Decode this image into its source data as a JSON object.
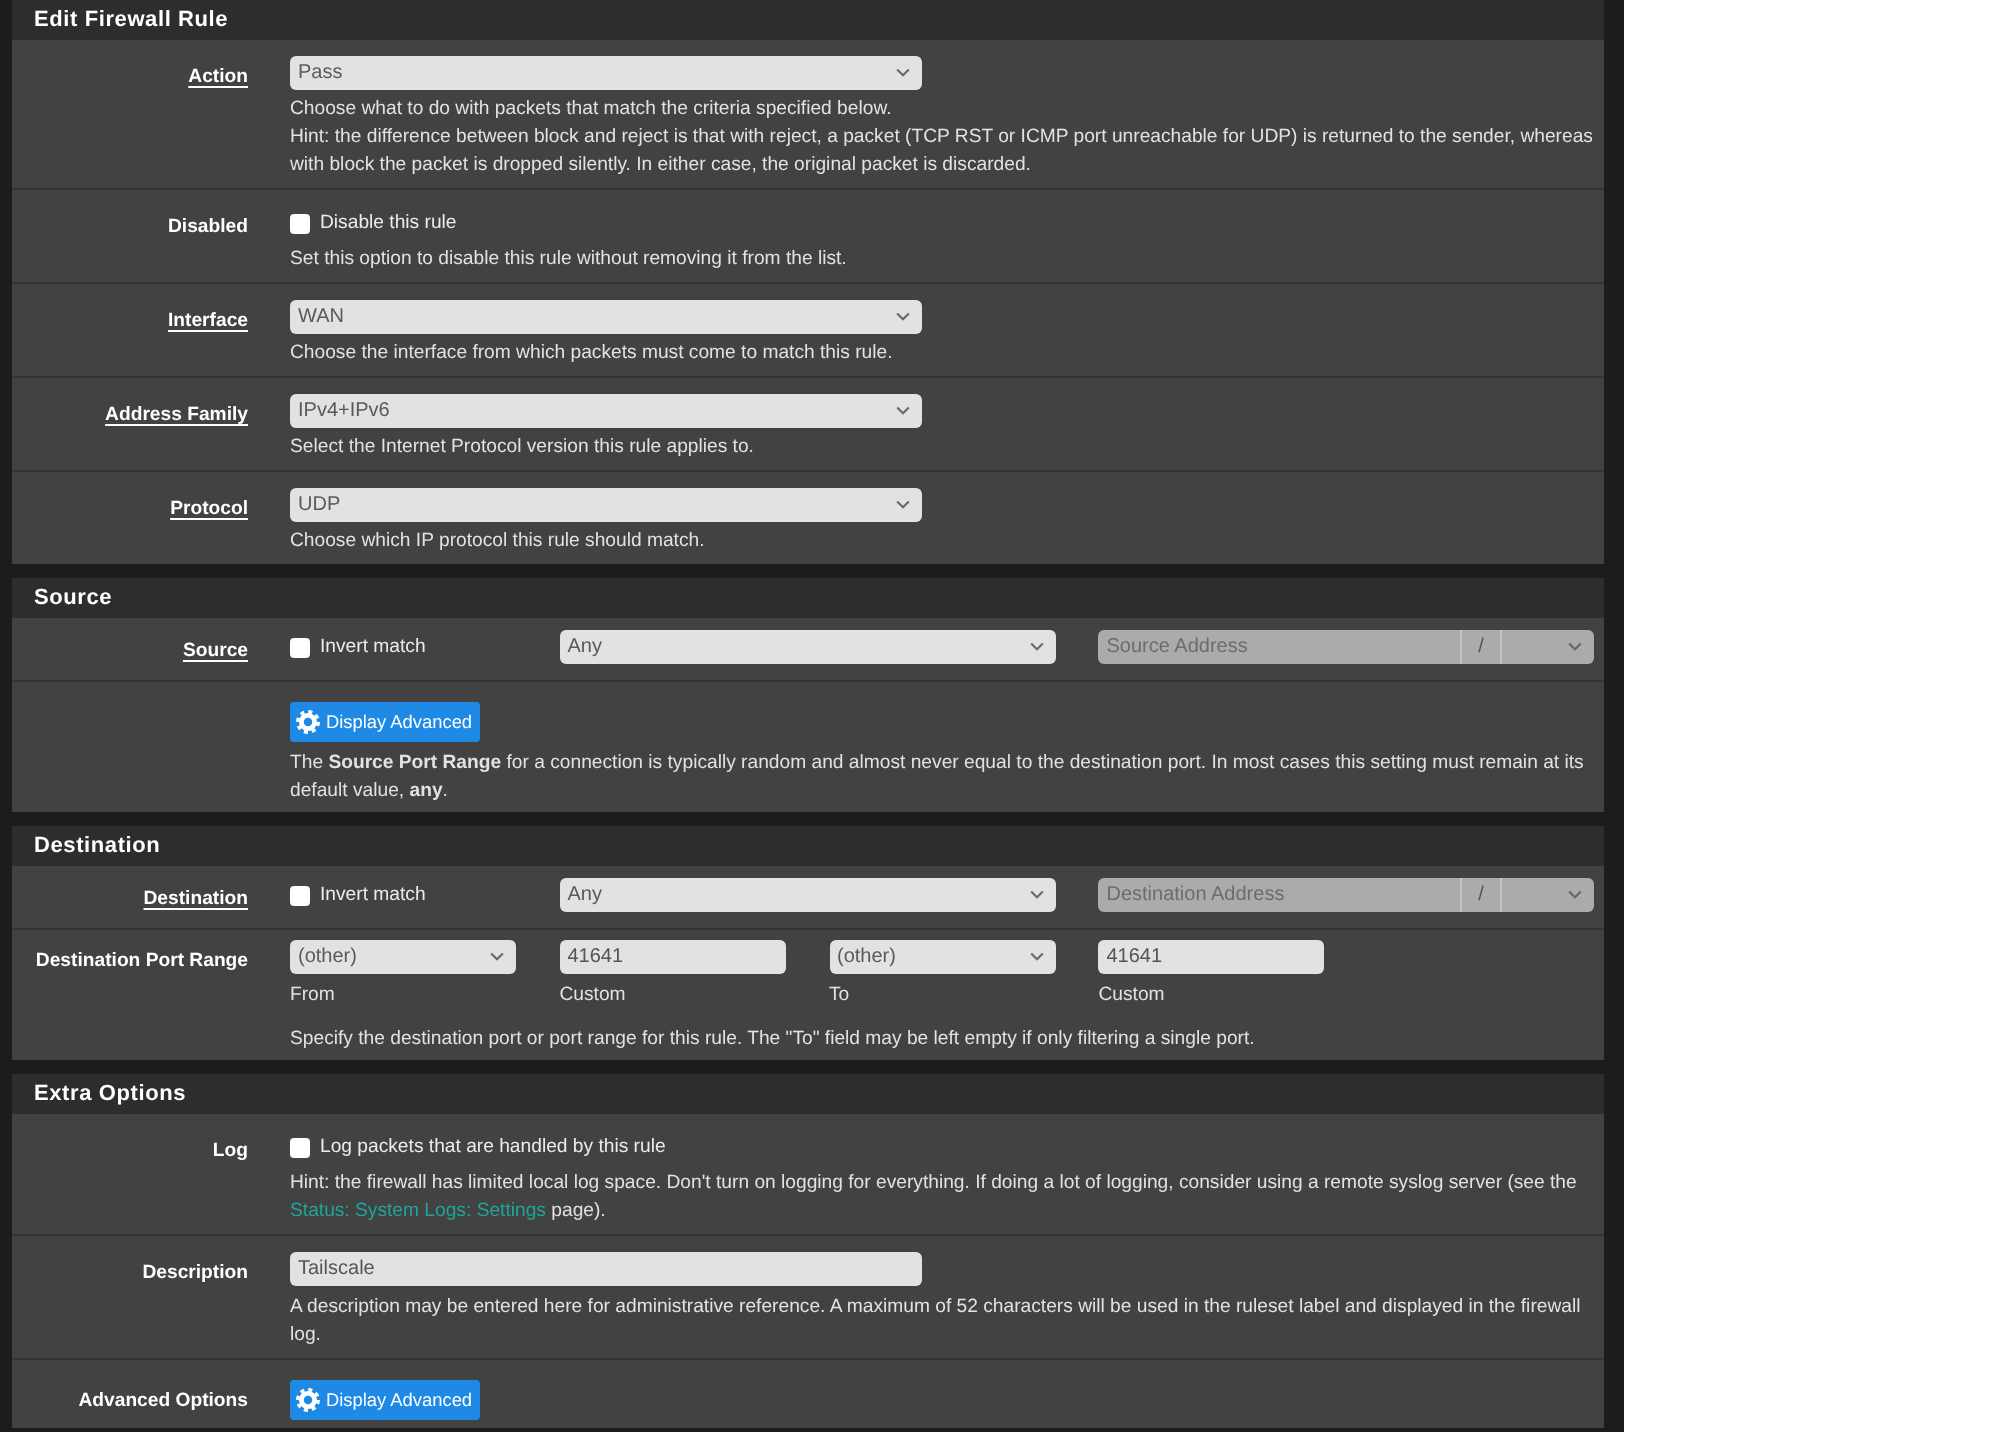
{
  "panels": [
    {
      "title": "Edit Firewall Rule",
      "rows": [
        {
          "kind": "select",
          "label": "Action",
          "link": true,
          "value": "Pass",
          "help": [
            "Choose what to do with packets that match the criteria specified below.",
            "Hint: the difference between block and reject is that with reject, a packet (TCP RST or ICMP port unreachable for UDP) is returned to the sender, whereas with block the packet is dropped silently. In either case, the original packet is discarded."
          ]
        },
        {
          "kind": "checkbox",
          "label": "Disabled",
          "link": false,
          "checkbox": {
            "label": "Disable this rule",
            "checked": false
          },
          "help": [
            "Set this option to disable this rule without removing it from the list."
          ]
        },
        {
          "kind": "select",
          "label": "Interface",
          "link": true,
          "value": "WAN",
          "help": [
            "Choose the interface from which packets must come to match this rule."
          ]
        },
        {
          "kind": "select",
          "label": "Address Family",
          "link": true,
          "value": "IPv4+IPv6",
          "help": [
            "Select the Internet Protocol version this rule applies to."
          ]
        },
        {
          "kind": "select",
          "label": "Protocol",
          "link": true,
          "value": "UDP",
          "help": [
            "Choose which IP protocol this rule should match."
          ]
        }
      ]
    },
    {
      "title": "Source",
      "rows": [
        {
          "kind": "address",
          "label": "Source",
          "link": true,
          "invert": {
            "label": "Invert match",
            "checked": false
          },
          "value": "Any",
          "address": {
            "placeholder": "Source Address",
            "separator": "/",
            "disabled": true
          }
        },
        {
          "kind": "advanced",
          "button": "Display Advanced",
          "help": [
            "The **Source Port Range** for a connection is typically random and almost never equal to the destination port. In most cases this setting must remain at its default value, **any**."
          ]
        }
      ]
    },
    {
      "title": "Destination",
      "rows": [
        {
          "kind": "address",
          "label": "Destination",
          "link": true,
          "invert": {
            "label": "Invert match",
            "checked": false
          },
          "value": "Any",
          "address": {
            "placeholder": "Destination Address",
            "separator": "/",
            "disabled": true
          }
        },
        {
          "kind": "port_range",
          "label": "Destination Port Range",
          "link": false,
          "fields": [
            {
              "kind": "select",
              "value": "(other)",
              "caption": "From"
            },
            {
              "kind": "input",
              "value": "41641",
              "caption": "Custom"
            },
            {
              "kind": "select",
              "value": "(other)",
              "caption": "To"
            },
            {
              "kind": "input",
              "value": "41641",
              "caption": "Custom"
            }
          ],
          "help": [
            "Specify the destination port or port range for this rule. The \"To\" field may be left empty if only filtering a single port."
          ]
        }
      ]
    },
    {
      "title": "Extra Options",
      "rows": [
        {
          "kind": "checkbox",
          "label": "Log",
          "link": false,
          "checkbox": {
            "label": "Log packets that are handled by this rule",
            "checked": false
          },
          "hint": {
            "before": "Hint: the firewall has limited local log space. Don't turn on logging for everything. If doing a lot of logging, consider using a remote syslog server (see the ",
            "link": "Status: System Logs: Settings",
            "after": " page)."
          }
        },
        {
          "kind": "input",
          "label": "Description",
          "link": false,
          "value": "Tailscale",
          "help": [
            "A description may be entered here for administrative reference. A maximum of 52 characters will be used in the ruleset label and displayed in the firewall log."
          ]
        },
        {
          "kind": "button",
          "label": "Advanced Options",
          "link": false,
          "button": "Display Advanced"
        }
      ]
    }
  ]
}
